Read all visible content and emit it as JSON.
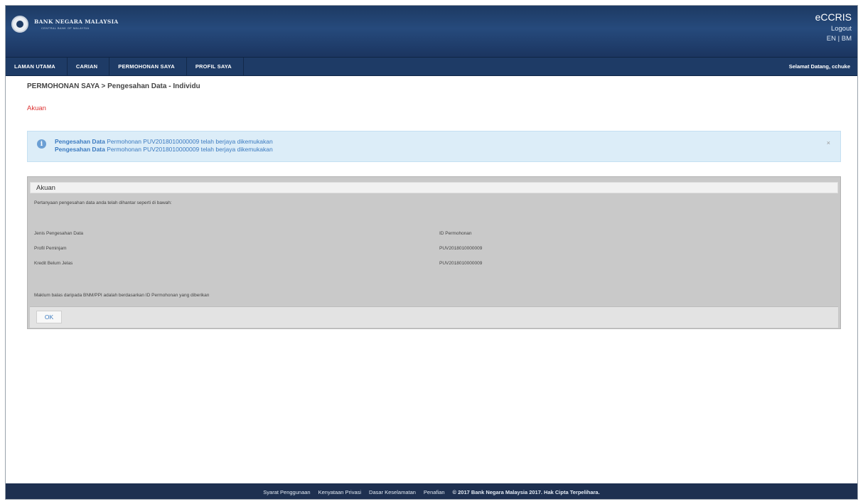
{
  "header": {
    "bank_name": "BANK NEGARA MALAYSIA",
    "bank_sub": "CENTRAL BANK OF MALAYSIA",
    "app_title": "eCCRIS",
    "logout": "Logout",
    "lang_en": "EN",
    "lang_sep": "|",
    "lang_bm": "BM"
  },
  "nav": {
    "items": [
      "LAMAN UTAMA",
      "CARIAN",
      "PERMOHONAN SAYA",
      "PROFIL SAYA"
    ],
    "welcome": "Selamat Datang, cchuke"
  },
  "breadcrumb": "PERMOHONAN SAYA > Pengesahan Data - Individu",
  "page_heading": "Akuan",
  "alert": {
    "lines": [
      {
        "bold": "Pengesahan Data",
        "rest": "Permohonan PUV2018010000009 telah berjaya dikemukakan"
      },
      {
        "bold": "Pengesahan Data",
        "rest": "Permohonan PUV2018010000009 telah berjaya dikemukakan"
      }
    ],
    "close": "×"
  },
  "panel": {
    "title": "Akuan",
    "intro": "Pertanyaan pengesahan data anda telah dihantar seperti di bawah:",
    "header_left": "Jenis Pengesahan Data",
    "header_right": "ID Permohonan",
    "rows": [
      {
        "label": "Profil Peminjam",
        "value": "PUV2018010000009"
      },
      {
        "label": "Kredit Belum Jelas",
        "value": "PUV2018010000009"
      }
    ],
    "note": "Maklum balas daripada BNM/PPI adalah berdasarkan ID Permohonan yang diberikan",
    "ok_label": "OK"
  },
  "footer": {
    "links": [
      "Syarat Penggunaan",
      "Kenyataan Privasi",
      "Dasar Keselamatan",
      "Penafian"
    ],
    "copyright": "© 2017 Bank Negara Malaysia 2017. Hak Cipta Terpelihara."
  }
}
